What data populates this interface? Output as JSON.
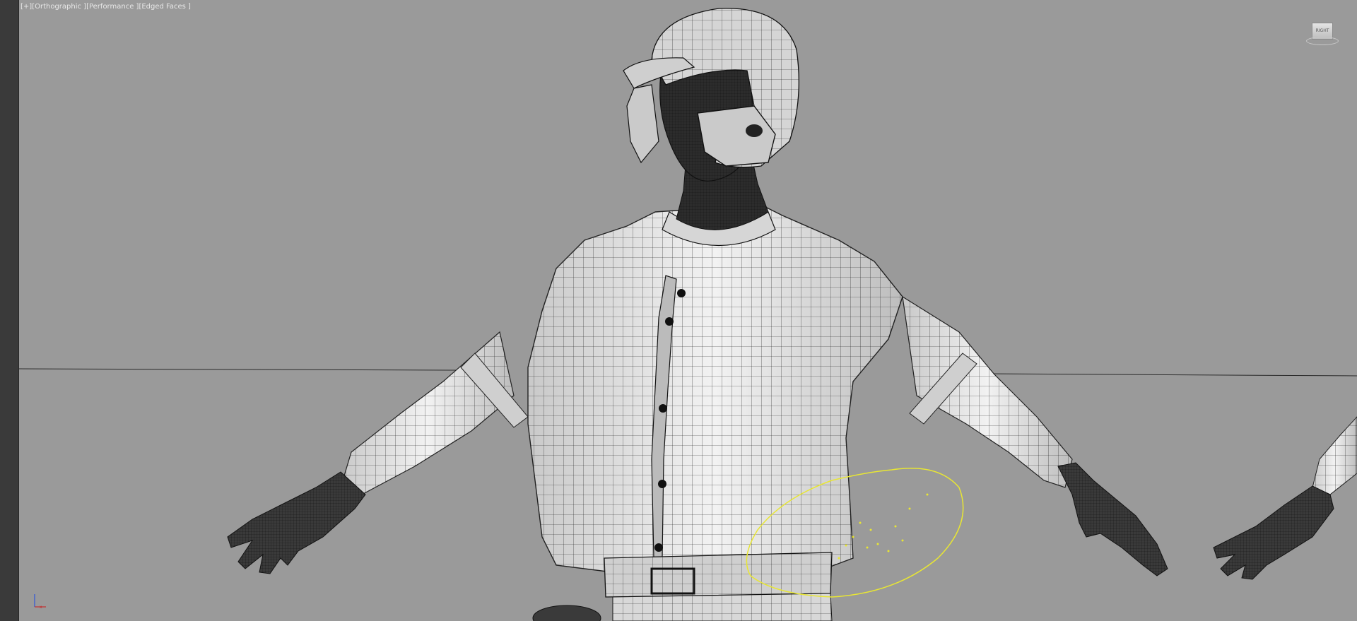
{
  "viewport": {
    "labels": {
      "plus": "[+]",
      "view": "[Orthographic ]",
      "mode": "[Performance ]",
      "shading": "[Edged Faces ]"
    },
    "viewcube": {
      "face": "RIGHT"
    },
    "axis": {
      "x": "x",
      "y": "y"
    }
  },
  "colors": {
    "background": "#9a9a9a",
    "mesh_fill": "#d8d8d8",
    "wire": "#1a1a1a",
    "spline": "#e8e633"
  }
}
